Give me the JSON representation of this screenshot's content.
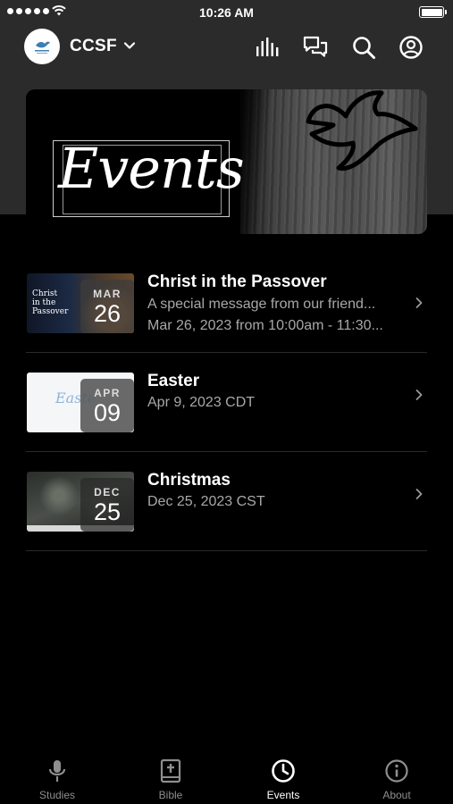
{
  "status_bar": {
    "time": "10:26 AM"
  },
  "header": {
    "app_name": "CCSF",
    "logo_text": "CCSF",
    "icons": [
      "audio-bars-icon",
      "chat-icon",
      "search-icon",
      "account-icon"
    ]
  },
  "banner": {
    "title": "Events"
  },
  "events": [
    {
      "title": "Christ in the Passover",
      "subtitle": "A special message from our friend...",
      "datetime": "Mar 26, 2023 from 10:00am - 11:30...",
      "month": "MAR",
      "day": "26",
      "thumb_text_1": "Christ",
      "thumb_text_2": "in the",
      "thumb_text_3": "Passover"
    },
    {
      "title": "Easter",
      "datetime": "Apr 9, 2023 CDT",
      "month": "APR",
      "day": "09",
      "thumb_text_1": "Easte"
    },
    {
      "title": "Christmas",
      "datetime": "Dec 25, 2023 CST",
      "month": "DEC",
      "day": "25"
    }
  ],
  "tabs": [
    {
      "label": "Studies",
      "icon": "microphone-icon"
    },
    {
      "label": "Bible",
      "icon": "bible-icon"
    },
    {
      "label": "Events",
      "icon": "clock-icon",
      "active": true
    },
    {
      "label": "About",
      "icon": "info-icon"
    }
  ],
  "colors": {
    "header_bg": "#2b2b2b",
    "background": "#000000",
    "subtitle_text": "#a8a8a8",
    "inactive_tab": "#8e8e8e"
  }
}
